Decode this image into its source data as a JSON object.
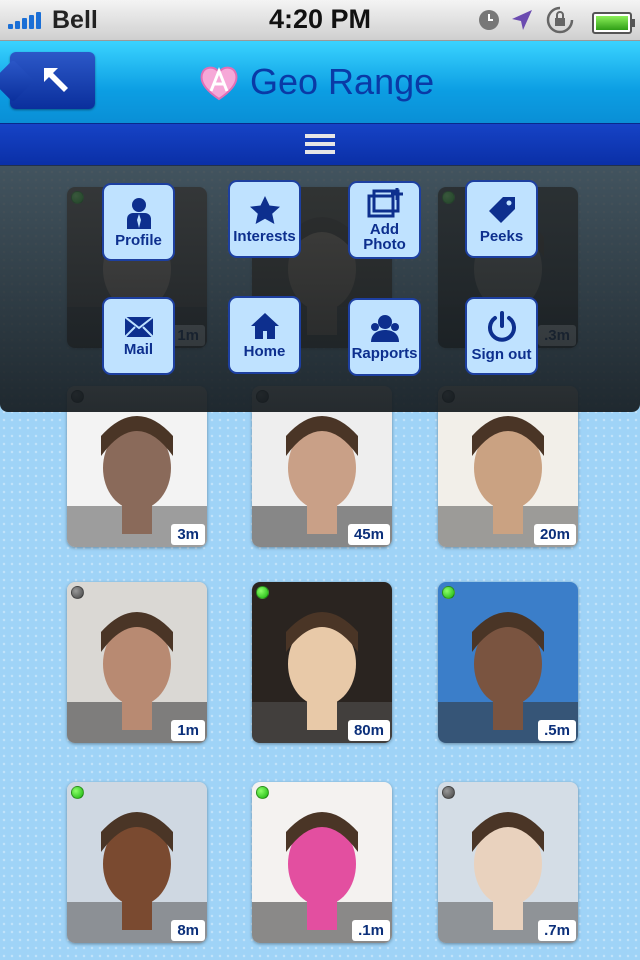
{
  "status": {
    "carrier": "Bell",
    "time": "4:20 PM"
  },
  "header": {
    "title": "Geo Range"
  },
  "menu": [
    {
      "label": "Profile",
      "icon": "person-icon"
    },
    {
      "label": "Interests",
      "icon": "star-icon"
    },
    {
      "label": "Add\nPhoto",
      "icon": "add-photo-icon"
    },
    {
      "label": "Peeks",
      "icon": "tag-icon"
    },
    {
      "label": "Mail",
      "icon": "envelope-icon"
    },
    {
      "label": "Home",
      "icon": "home-icon"
    },
    {
      "label": "Rapports",
      "icon": "people-icon"
    },
    {
      "label": "Sign out",
      "icon": "power-icon"
    }
  ],
  "users": [
    {
      "distance": "1m",
      "online": true
    },
    {
      "distance": "",
      "online": false
    },
    {
      "distance": ".3m",
      "online": true
    },
    {
      "distance": "3m",
      "online": false
    },
    {
      "distance": "45m",
      "online": false
    },
    {
      "distance": "20m",
      "online": false
    },
    {
      "distance": "1m",
      "online": false
    },
    {
      "distance": "80m",
      "online": true
    },
    {
      "distance": ".5m",
      "online": true
    },
    {
      "distance": "8m",
      "online": true
    },
    {
      "distance": ".1m",
      "online": true
    },
    {
      "distance": ".7m",
      "online": false
    }
  ],
  "colors": {
    "accent": "#0a3aa6",
    "header": "#0c9ee3",
    "menubar": "#1643c6",
    "background": "#9fd3f7"
  }
}
